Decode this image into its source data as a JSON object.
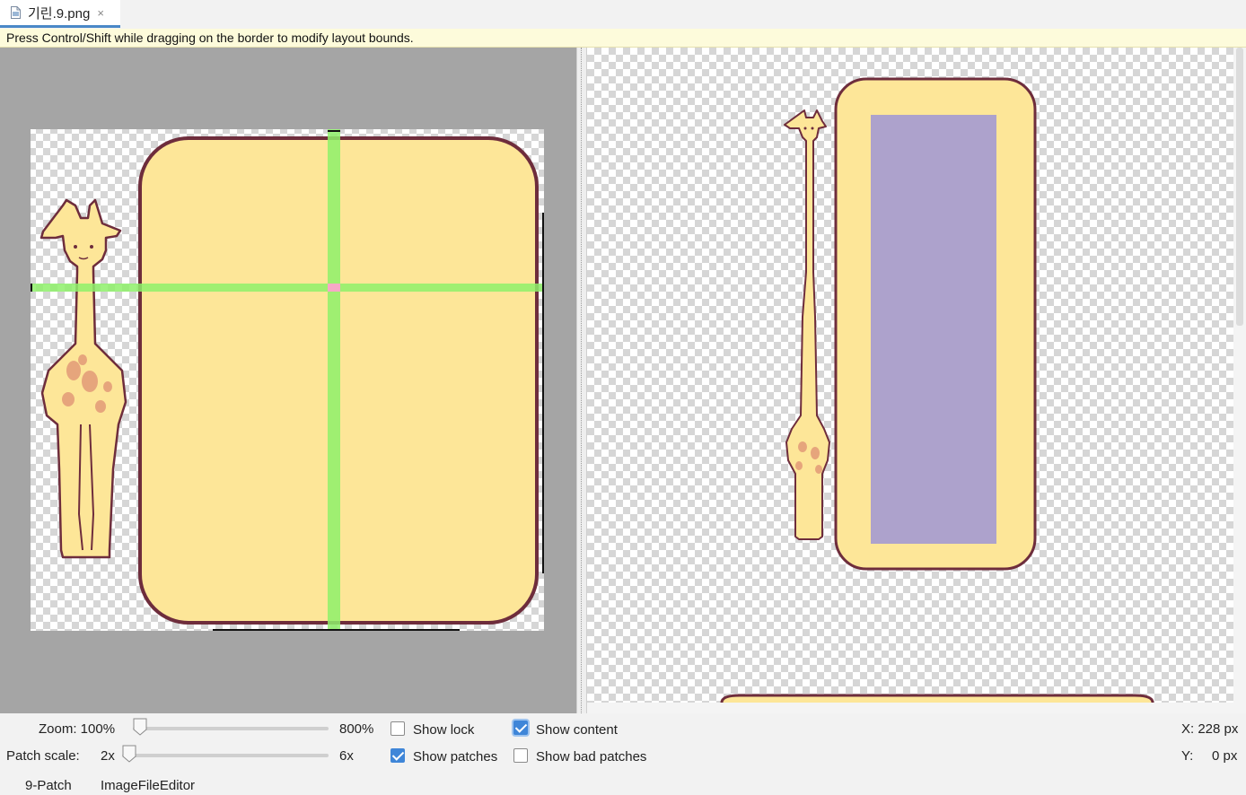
{
  "tab": {
    "icon": "image-file-icon",
    "title": "기린.9.png",
    "close": "×"
  },
  "hint": "Press Control/Shift while dragging on the border to modify layout bounds.",
  "controls": {
    "zoom_label": "Zoom: 100%",
    "zoom_max": "800%",
    "zoom_level_fraction": 0.0,
    "patch_scale_label": "Patch scale:",
    "patch_scale_min": "2x",
    "patch_scale_max": "6x",
    "patch_scale_fraction": 0.0,
    "show_lock": {
      "label": "Show lock",
      "checked": false
    },
    "show_patches": {
      "label": "Show patches",
      "checked": true
    },
    "show_content": {
      "label": "Show content",
      "checked": true
    },
    "show_bad_patches": {
      "label": "Show bad patches",
      "checked": false
    },
    "x_readout": "X: 228 px",
    "y_label": "Y:",
    "y_value": "0 px"
  },
  "bottom_tabs": [
    "9-Patch",
    "ImageFileEditor"
  ],
  "colors": {
    "fill": "#fde698",
    "outline": "#6e2d3c",
    "patch": "#8ef06a",
    "patch_cross": "#f7a8c6",
    "content": "#ada2cc",
    "giraffe_body": "#fde698",
    "giraffe_spots": "#e6a57c"
  }
}
